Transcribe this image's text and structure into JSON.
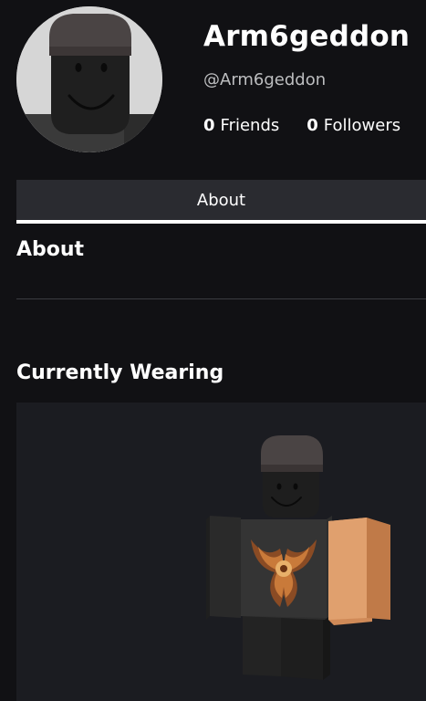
{
  "profile": {
    "display_name": "Arm6geddon",
    "username": "@Arm6geddon",
    "friends_count": "0",
    "friends_label": "Friends",
    "followers_count": "0",
    "followers_label": "Followers"
  },
  "tabs": [
    {
      "label": "About",
      "selected": true
    }
  ],
  "about": {
    "heading": "About"
  },
  "currently_wearing": {
    "heading": "Currently Wearing"
  },
  "colors": {
    "background": "#111114",
    "tab_background": "#2a2b30",
    "viewer_background": "#1b1c21",
    "avatar_background": "#d4d4d4",
    "muted_text": "#bdbec0"
  },
  "icons": [
    "avatar-headshot",
    "avatar-3d-model"
  ]
}
